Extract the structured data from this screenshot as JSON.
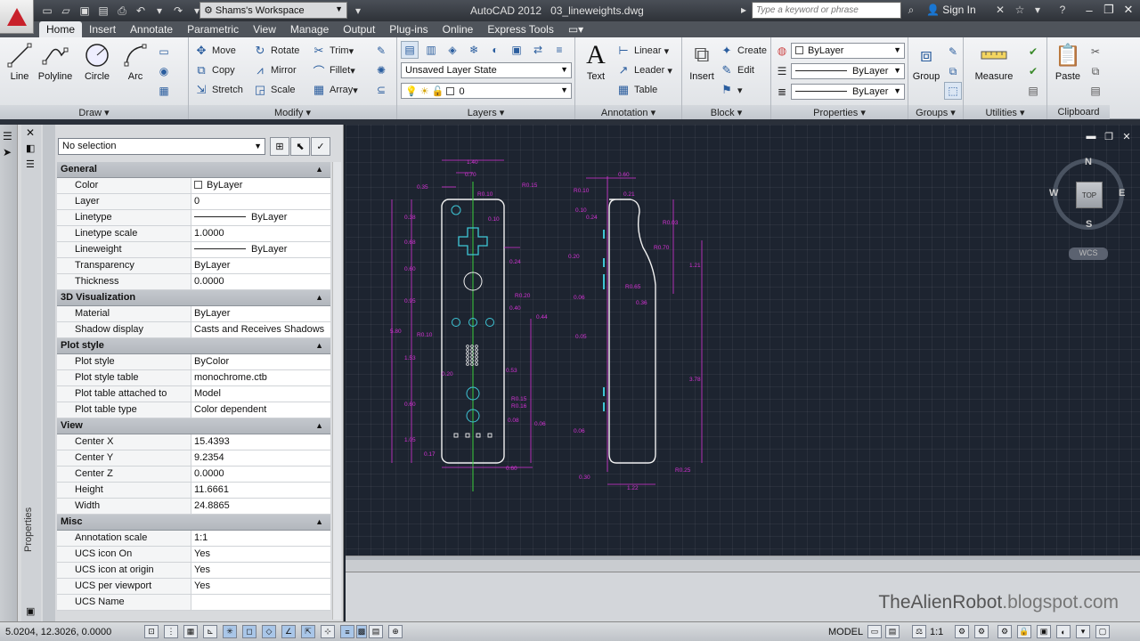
{
  "app": {
    "title": "AutoCAD 2012",
    "file": "03_lineweights.dwg",
    "workspace": "Shams's Workspace",
    "search_placeholder": "Type a keyword or phrase",
    "signin": "Sign In"
  },
  "tabs": [
    "Home",
    "Insert",
    "Annotate",
    "Parametric",
    "View",
    "Manage",
    "Output",
    "Plug-ins",
    "Online",
    "Express Tools"
  ],
  "ribbon": {
    "draw": {
      "title": "Draw",
      "line": "Line",
      "polyline": "Polyline",
      "circle": "Circle",
      "arc": "Arc"
    },
    "modify": {
      "title": "Modify",
      "move": "Move",
      "rotate": "Rotate",
      "trim": "Trim",
      "copy": "Copy",
      "mirror": "Mirror",
      "fillet": "Fillet",
      "stretch": "Stretch",
      "scale": "Scale",
      "array": "Array"
    },
    "layers": {
      "title": "Layers",
      "state": "Unsaved Layer State",
      "current": "0"
    },
    "annotation": {
      "title": "Annotation",
      "text": "Text",
      "linear": "Linear",
      "leader": "Leader",
      "table": "Table"
    },
    "block": {
      "title": "Block",
      "insert": "Insert",
      "create": "Create",
      "edit": "Edit"
    },
    "properties": {
      "title": "Properties",
      "color": "ByLayer",
      "linetype": "ByLayer",
      "lineweight": "ByLayer"
    },
    "groups": {
      "title": "Groups",
      "group": "Group"
    },
    "utilities": {
      "title": "Utilities",
      "measure": "Measure"
    },
    "clipboard": {
      "title": "Clipboard",
      "paste": "Paste"
    }
  },
  "properties_palette": {
    "selection": "No selection",
    "vertical_label": "Properties",
    "categories": [
      {
        "name": "General",
        "rows": [
          {
            "k": "Color",
            "v": "ByLayer"
          },
          {
            "k": "Layer",
            "v": "0"
          },
          {
            "k": "Linetype",
            "v": "ByLayer"
          },
          {
            "k": "Linetype scale",
            "v": "1.0000"
          },
          {
            "k": "Lineweight",
            "v": "ByLayer"
          },
          {
            "k": "Transparency",
            "v": "ByLayer"
          },
          {
            "k": "Thickness",
            "v": "0.0000"
          }
        ]
      },
      {
        "name": "3D Visualization",
        "rows": [
          {
            "k": "Material",
            "v": "ByLayer"
          },
          {
            "k": "Shadow display",
            "v": "Casts and Receives Shadows"
          }
        ]
      },
      {
        "name": "Plot style",
        "rows": [
          {
            "k": "Plot style",
            "v": "ByColor"
          },
          {
            "k": "Plot style table",
            "v": "monochrome.ctb"
          },
          {
            "k": "Plot table attached to",
            "v": "Model"
          },
          {
            "k": "Plot table type",
            "v": "Color dependent"
          }
        ]
      },
      {
        "name": "View",
        "rows": [
          {
            "k": "Center X",
            "v": "15.4393"
          },
          {
            "k": "Center Y",
            "v": "9.2354"
          },
          {
            "k": "Center Z",
            "v": "0.0000"
          },
          {
            "k": "Height",
            "v": "11.6661"
          },
          {
            "k": "Width",
            "v": "24.8865"
          }
        ]
      },
      {
        "name": "Misc",
        "rows": [
          {
            "k": "Annotation scale",
            "v": "1:1"
          },
          {
            "k": "UCS icon On",
            "v": "Yes"
          },
          {
            "k": "UCS icon at origin",
            "v": "Yes"
          },
          {
            "k": "UCS per viewport",
            "v": "Yes"
          },
          {
            "k": "UCS Name",
            "v": ""
          }
        ]
      }
    ]
  },
  "viewcube": {
    "n": "N",
    "s": "S",
    "e": "E",
    "w": "W",
    "top": "TOP",
    "wcs": "WCS"
  },
  "drawing_labels": {
    "front": [
      "1.40",
      "0.70",
      "0.35",
      "R0.10",
      "R0.15",
      "0.10",
      "0.38",
      "0.68",
      "0.24",
      "0.60",
      "R0.20",
      "0.95",
      "0.40",
      "0.44",
      "R0.10",
      "5.80",
      "1.53",
      "0.53",
      "0.20",
      "R0.15",
      "R0.16",
      "0.60",
      "0.08",
      "0.06",
      "1.05",
      "0.17",
      "0.60"
    ],
    "side": [
      "0.60",
      "R0.10",
      "0.21",
      "0.10",
      "0.24",
      "R0.03",
      "R0.70",
      "0.20",
      "1.21",
      "R0.65",
      "0.06",
      "0.36",
      "0.05",
      "3.78",
      "0.06",
      "R0.25",
      "0.30",
      "1.22"
    ]
  },
  "watermark": {
    "a": "TheAlienRobot",
    "b": ".blogspot.com"
  },
  "status": {
    "coords": "5.0204, 12.3026, 0.0000",
    "model": "MODEL",
    "scale": "1:1"
  }
}
